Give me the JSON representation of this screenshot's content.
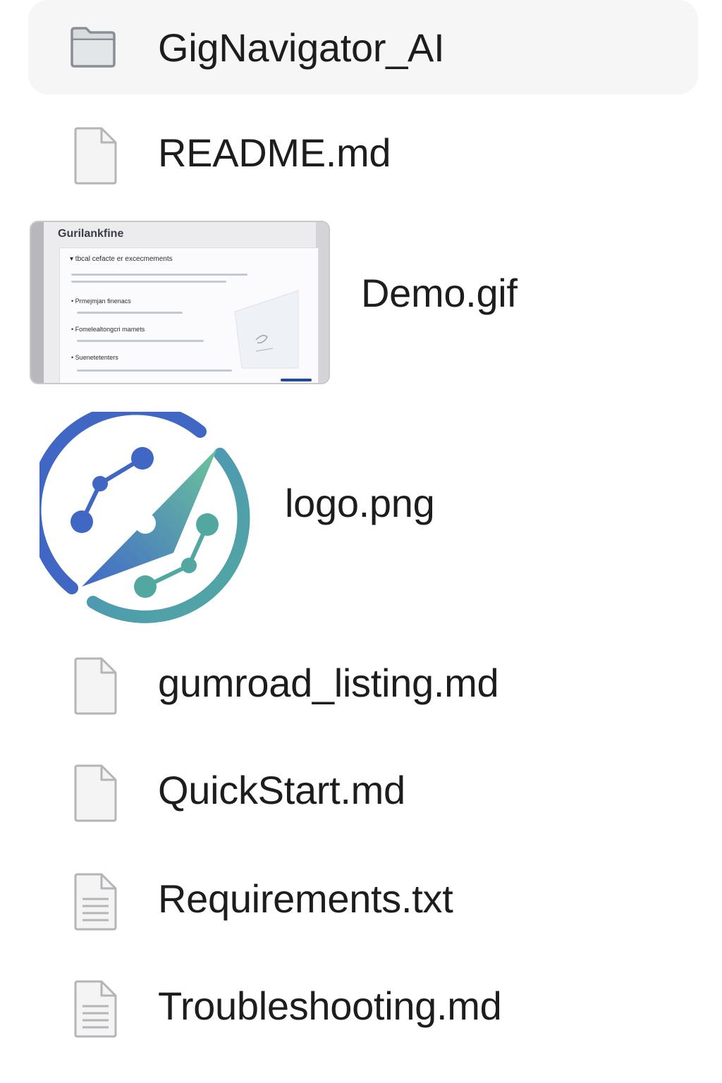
{
  "files": {
    "folder": {
      "name": "GigNavigator_AI",
      "icon": "folder-icon"
    },
    "readme": {
      "name": "README.md",
      "icon": "blank-document-icon"
    },
    "demo": {
      "name": "Demo.gif",
      "icon": "gif-thumbnail",
      "thumbnail": {
        "title": "Gurilankfine",
        "section": "▾ tbcal cefacte er excecmements",
        "bullets": [
          "Prmejmjan finenacs",
          "Fomelealtongcri mamets",
          "Suenetetenters"
        ]
      }
    },
    "logo": {
      "name": "logo.png",
      "icon": "compass-logo"
    },
    "gumroad": {
      "name": "gumroad_listing.md",
      "icon": "blank-document-icon"
    },
    "quickstart": {
      "name": "QuickStart.md",
      "icon": "blank-document-icon"
    },
    "requirements": {
      "name": "Requirements.txt",
      "icon": "text-document-icon"
    },
    "troubleshooting": {
      "name": "Troubleshooting.md",
      "icon": "text-document-icon"
    }
  },
  "colors": {
    "text": "#1d1d1f",
    "folder_row_bg": "#f6f6f6",
    "icon_stroke": "#a9abb0",
    "logo_blue": "#3f68c8",
    "logo_teal": "#52a8a0"
  }
}
